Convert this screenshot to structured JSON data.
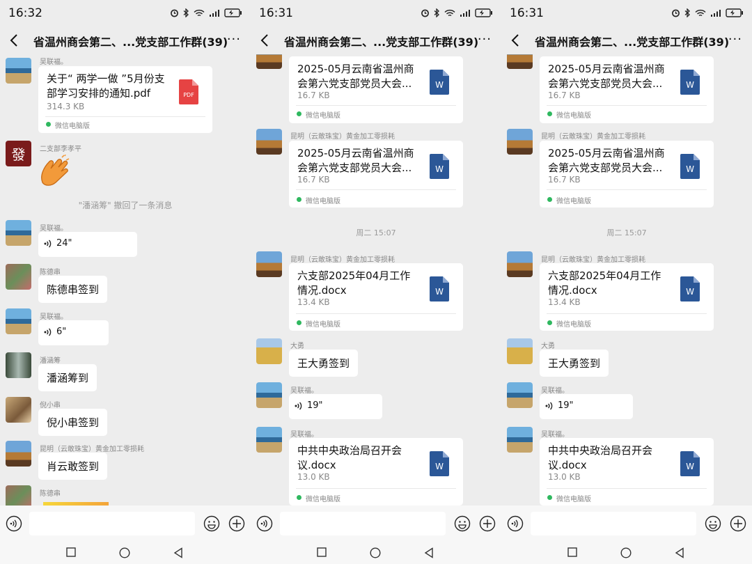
{
  "colors": {
    "background": "#ededed",
    "bubble": "#ffffff",
    "word_icon": "#2b5797",
    "pdf_icon": "#e64343",
    "source_dot": "#2fb85f"
  },
  "panels": [
    {
      "status_time": "16:32",
      "title": "省温州商会第二、...党支部工作群(39)",
      "more": "···",
      "messages": [
        {
          "sender": "吴联福。",
          "file_name": "关于“ 两学一做 ”5月份支部学习安排的通知.pdf",
          "file_size": "314.3 KB",
          "source": "微信电脑版",
          "icon": "pdf-icon",
          "icon_label": "PDF"
        },
        {
          "sender": "二支部李孝平",
          "avatar_text": "發"
        },
        {
          "recall": "\"潘涵筹\" 撤回了一条消息"
        },
        {
          "sender": "吴联福。",
          "voice": "24\""
        },
        {
          "sender": "陈德串",
          "text": "陈德串签到"
        },
        {
          "sender": "吴联福。",
          "voice": "6\""
        },
        {
          "sender": "潘涵筹",
          "text": "潘涵筹到"
        },
        {
          "sender": "倪小串",
          "text": "倪小串签到"
        },
        {
          "sender": "昆明（云敢珠宝）黄金加工零损耗",
          "text": "肖云敢签到"
        },
        {
          "sender": "陈德串"
        }
      ]
    },
    {
      "status_time": "16:31",
      "title": "省温州商会第二、...党支部工作群(39)",
      "more": "···",
      "messages": [
        {
          "file_name": "2025-05月云南省温州商会第六党支部党员大会...",
          "file_size": "16.7 KB",
          "source": "微信电脑版",
          "icon_label": "W"
        },
        {
          "sender": "昆明（云敢珠宝）黄金加工零损耗",
          "file_name": "2025-05月云南省温州商会第六党支部党员大会...",
          "file_size": "16.7 KB",
          "source": "微信电脑版",
          "icon_label": "W"
        },
        {
          "timestamp": "周二 15:07"
        },
        {
          "sender": "昆明（云敢珠宝）黄金加工零损耗",
          "file_name": "六支部2025年04月工作情况.docx",
          "file_size": "13.4 KB",
          "source": "微信电脑版",
          "icon_label": "W"
        },
        {
          "sender": "大勇",
          "text": "王大勇签到"
        },
        {
          "sender": "吴联福。",
          "voice": "19\""
        },
        {
          "sender": "吴联福。",
          "file_name": "中共中央政治局召开会议.docx",
          "file_size": "13.0 KB",
          "source": "微信电脑版",
          "icon_label": "W"
        }
      ]
    },
    {
      "status_time": "16:31",
      "title": "省温州商会第二、...党支部工作群(39)",
      "more": "···",
      "messages": [
        {
          "file_name": "2025-05月云南省温州商会第六党支部党员大会...",
          "file_size": "16.7 KB",
          "source": "微信电脑版",
          "icon_label": "W"
        },
        {
          "sender": "昆明（云敢珠宝）黄金加工零损耗",
          "file_name": "2025-05月云南省温州商会第六党支部党员大会...",
          "file_size": "16.7 KB",
          "source": "微信电脑版",
          "icon_label": "W"
        },
        {
          "timestamp": "周二 15:07"
        },
        {
          "sender": "昆明（云敢珠宝）黄金加工零损耗",
          "file_name": "六支部2025年04月工作情况.docx",
          "file_size": "13.4 KB",
          "source": "微信电脑版",
          "icon_label": "W"
        },
        {
          "sender": "大勇",
          "text": "王大勇签到"
        },
        {
          "sender": "吴联福。",
          "voice": "19\""
        },
        {
          "sender": "吴联福。",
          "file_name": "中共中央政治局召开会议.docx",
          "file_size": "13.0 KB",
          "source": "微信电脑版",
          "icon_label": "W"
        }
      ]
    }
  ]
}
